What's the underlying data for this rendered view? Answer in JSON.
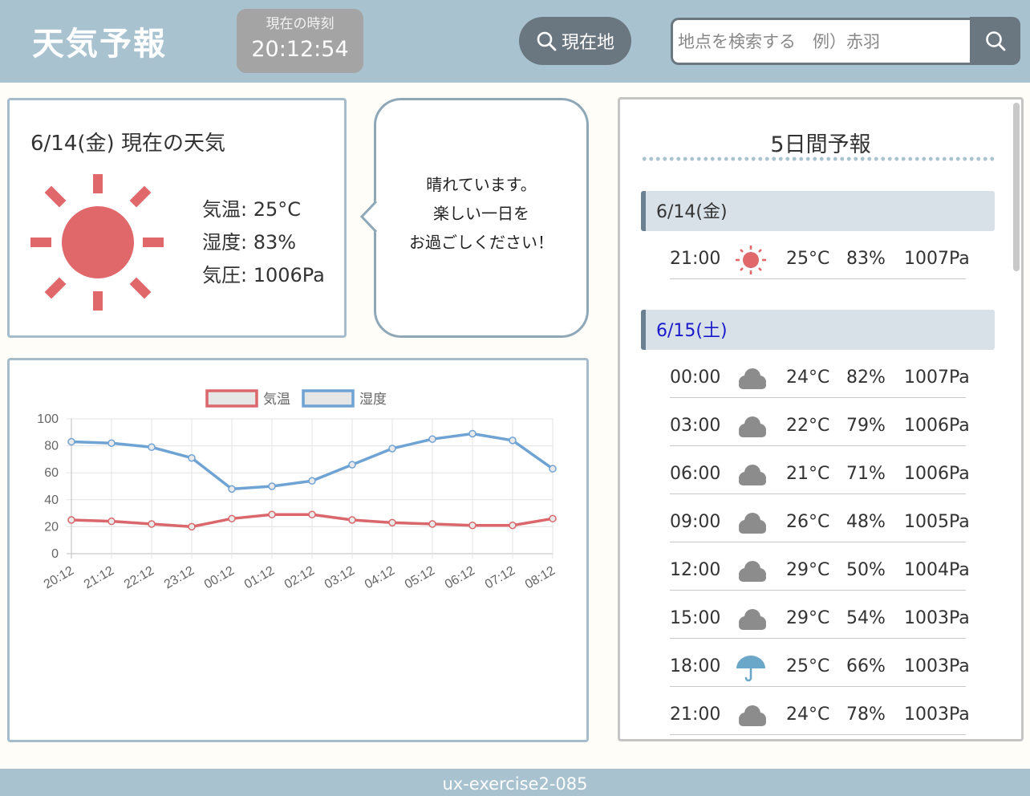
{
  "header": {
    "title": "天気予報",
    "clock_label": "現在の時刻",
    "clock_time": "20:12:54",
    "current_location_label": "現在地",
    "search_placeholder": "地点を検索する　例）赤羽"
  },
  "current": {
    "title": "6/14(金) 現在の天気",
    "icon": "sun-icon",
    "temperature": "気温: 25°C",
    "humidity": "湿度: 83%",
    "pressure": "気圧: 1006Pa"
  },
  "bubble": {
    "lines": [
      "晴れています。",
      "楽しい一日を",
      "お過ごしください！"
    ]
  },
  "chart_data": {
    "type": "line",
    "categories": [
      "20:12",
      "21:12",
      "22:12",
      "23:12",
      "00:12",
      "01:12",
      "02:12",
      "03:12",
      "04:12",
      "05:12",
      "06:12",
      "07:12",
      "08:12"
    ],
    "series": [
      {
        "name": "気温",
        "color": "#d9676b",
        "values": [
          25,
          24,
          22,
          20,
          26,
          29,
          29,
          25,
          23,
          22,
          21,
          21,
          26
        ]
      },
      {
        "name": "湿度",
        "color": "#6fa3d4",
        "values": [
          83,
          82,
          79,
          71,
          48,
          50,
          54,
          66,
          78,
          85,
          89,
          84,
          63
        ]
      }
    ],
    "yticks": [
      "100",
      "80",
      "60",
      "40",
      "20",
      "0"
    ],
    "ylim": [
      0,
      100
    ],
    "grid": true,
    "legend_position": "top"
  },
  "forecast": {
    "title": "5日間予報",
    "days": [
      {
        "label": "6/14(金)",
        "color": "#333333",
        "rows": [
          {
            "time": "21:00",
            "icon": "sun-icon",
            "temp": "25°C",
            "humidity": "83%",
            "pressure": "1007Pa"
          }
        ]
      },
      {
        "label": "6/15(土)",
        "color": "#1a1acc",
        "rows": [
          {
            "time": "00:00",
            "icon": "cloud-icon",
            "temp": "24°C",
            "humidity": "82%",
            "pressure": "1007Pa"
          },
          {
            "time": "03:00",
            "icon": "cloud-icon",
            "temp": "22°C",
            "humidity": "79%",
            "pressure": "1006Pa"
          },
          {
            "time": "06:00",
            "icon": "cloud-icon",
            "temp": "21°C",
            "humidity": "71%",
            "pressure": "1006Pa"
          },
          {
            "time": "09:00",
            "icon": "cloud-icon",
            "temp": "26°C",
            "humidity": "48%",
            "pressure": "1005Pa"
          },
          {
            "time": "12:00",
            "icon": "cloud-icon",
            "temp": "29°C",
            "humidity": "50%",
            "pressure": "1004Pa"
          },
          {
            "time": "15:00",
            "icon": "cloud-icon",
            "temp": "29°C",
            "humidity": "54%",
            "pressure": "1003Pa"
          },
          {
            "time": "18:00",
            "icon": "umbrella-icon",
            "temp": "25°C",
            "humidity": "66%",
            "pressure": "1003Pa"
          },
          {
            "time": "21:00",
            "icon": "cloud-icon",
            "temp": "24°C",
            "humidity": "78%",
            "pressure": "1003Pa"
          }
        ]
      }
    ]
  },
  "footer": {
    "text": "ux-exercise2-085"
  }
}
